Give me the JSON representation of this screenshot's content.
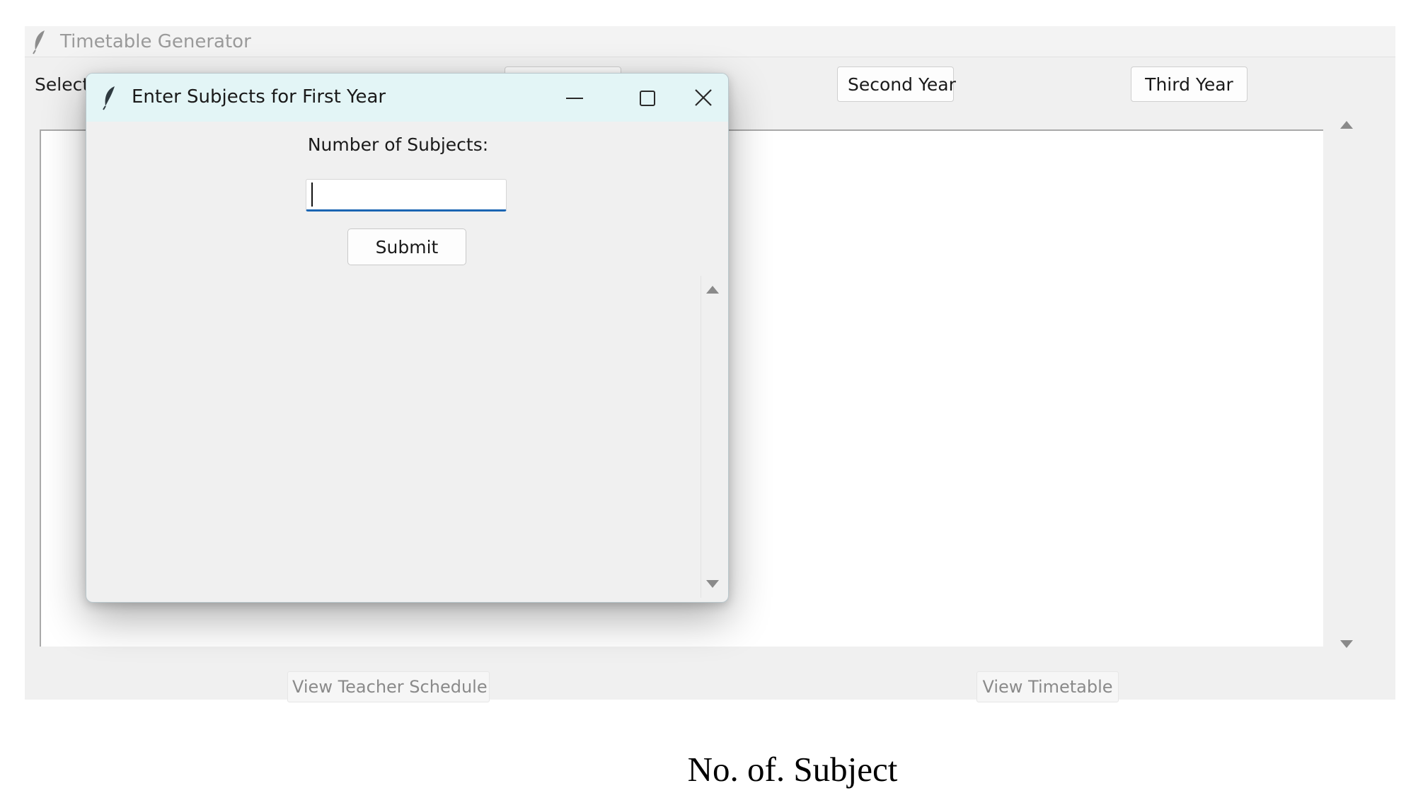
{
  "main_window": {
    "title": "Timetable Generator",
    "select_label": "Select",
    "year_buttons": {
      "first": "",
      "second": "Second Year",
      "third": "Third Year"
    },
    "footer": {
      "teacher_schedule": "View Teacher Schedule",
      "timetable": "View Timetable"
    }
  },
  "dialog": {
    "title": "Enter Subjects for First Year",
    "controls": {
      "minimize": "minimize-icon",
      "maximize": "maximize-icon",
      "close": "close-icon"
    },
    "number_label": "Number of Subjects:",
    "number_value": "",
    "submit_label": "Submit"
  },
  "caption": "No. of. Subject",
  "icons": {
    "app": "feather-icon",
    "scroll_up": "scroll-up-arrow-icon",
    "scroll_down": "scroll-down-arrow-icon"
  },
  "colors": {
    "dialog_titlebar": "#e3f5f6",
    "input_focus": "#1b65b3",
    "window_bg": "#f0f0f0"
  }
}
